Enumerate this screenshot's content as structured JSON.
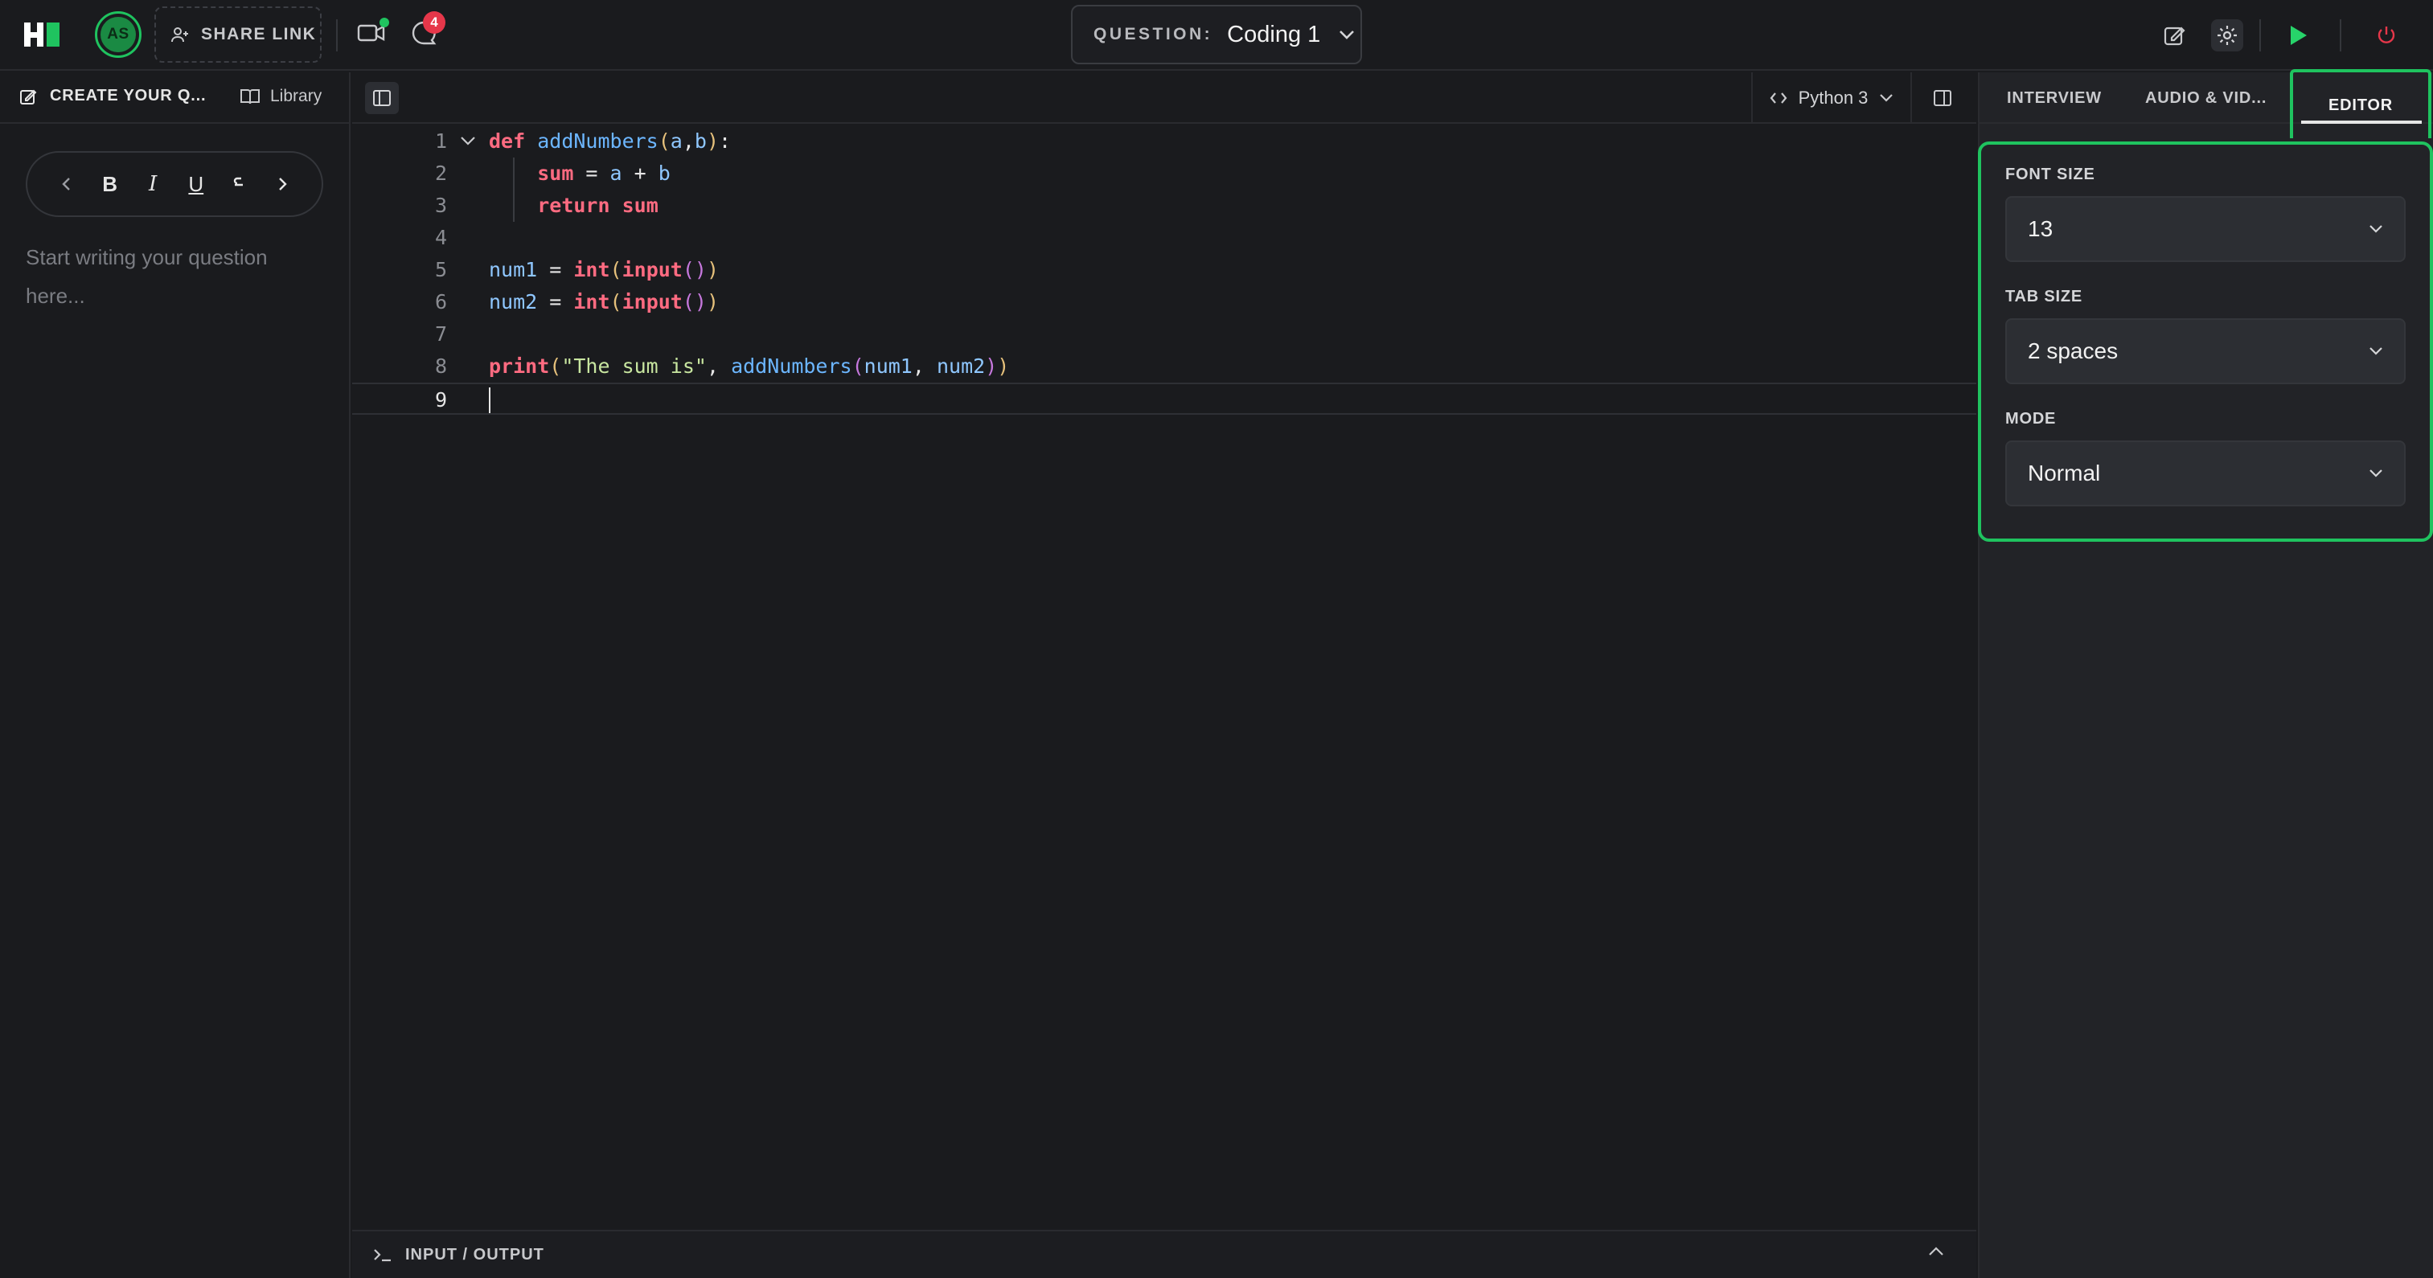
{
  "app": {
    "logo_text": "H",
    "user_initials": "AS"
  },
  "header": {
    "share_link_label": "SHARE LINK",
    "chat_badge_count": "4",
    "question_label": "QUESTION:",
    "question_value": "Coding 1"
  },
  "left_panel": {
    "tab_create": "CREATE YOUR Q...",
    "tab_library": "Library",
    "placeholder": "Start writing your question here..."
  },
  "editor": {
    "language": "Python 3",
    "line_numbers": [
      "1",
      "2",
      "3",
      "4",
      "5",
      "6",
      "7",
      "8",
      "9"
    ],
    "code_lines": [
      "def addNumbers(a,b):",
      "    sum = a + b",
      "    return sum",
      "",
      "num1 = int(input())",
      "num2 = int(input())",
      "",
      "print(\"The sum is\", addNumbers(num1, num2))",
      ""
    ],
    "io_label": "INPUT / OUTPUT"
  },
  "right_panel": {
    "tabs": [
      "INTERVIEW",
      "AUDIO & VID...",
      "EDITOR"
    ],
    "active_tab": "EDITOR",
    "font_size_label": "FONT SIZE",
    "font_size_value": "13",
    "tab_size_label": "TAB SIZE",
    "tab_size_value": "2 spaces",
    "mode_label": "MODE",
    "mode_value": "Normal"
  },
  "colors": {
    "accent": "#1fc35f",
    "badge": "#e6374a",
    "run": "#27d46a",
    "power": "#e6374a"
  }
}
